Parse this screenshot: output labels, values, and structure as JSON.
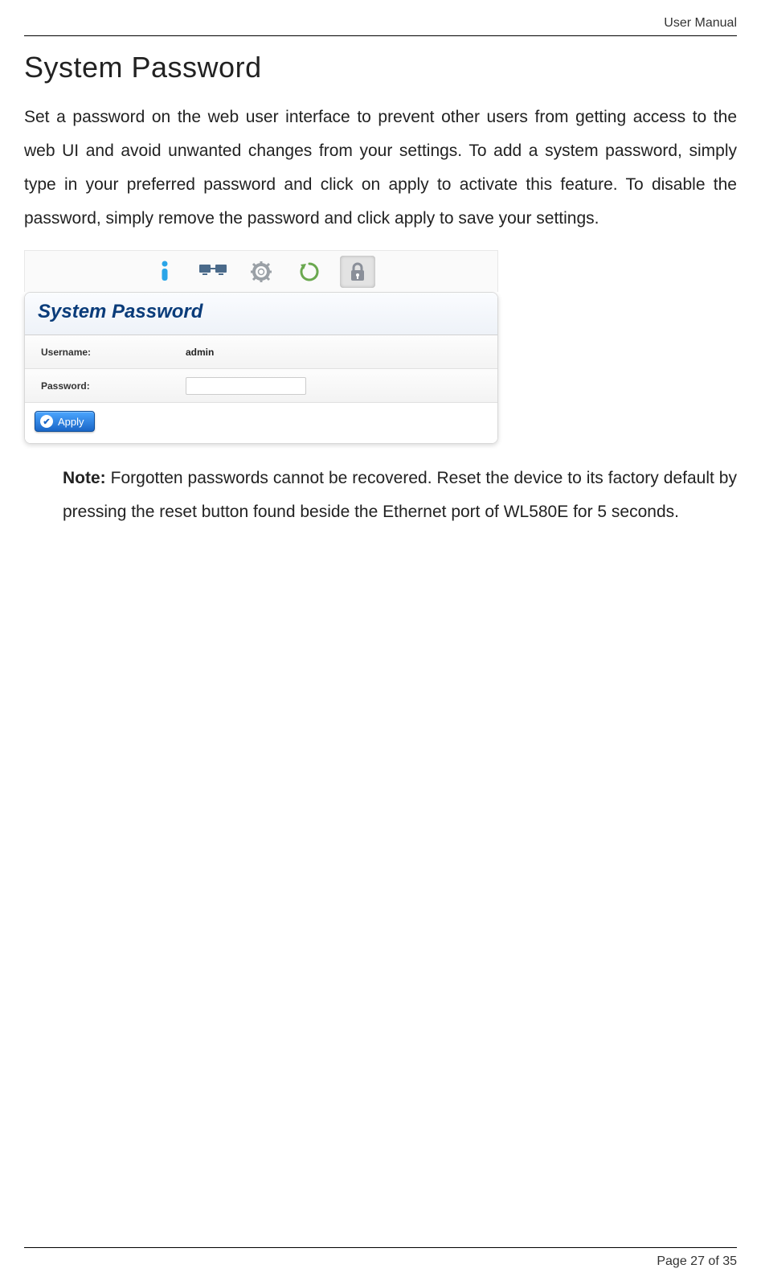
{
  "header": {
    "label": "User Manual"
  },
  "title": "System Password",
  "body": "Set a password on the web user interface to prevent other users from getting access to the web UI and avoid unwanted changes from your settings. To add a system password, simply type in your preferred password and click on apply to activate this feature. To disable the password, simply remove the password and click apply to save your settings.",
  "screenshot": {
    "tabs": {
      "info_icon": "info-icon",
      "network_icon": "network-icon",
      "settings_icon": "gear-icon",
      "reboot_icon": "reboot-icon",
      "security_icon": "lock-icon"
    },
    "panel_title": "System Password",
    "username_label": "Username:",
    "username_value": "admin",
    "password_label": "Password:",
    "password_value": "",
    "apply_label": "Apply"
  },
  "note": {
    "prefix": "Note:",
    "text": " Forgotten passwords cannot be recovered. Reset the device to its factory default by pressing the reset button found beside the Ethernet port of WL580E for 5 seconds."
  },
  "footer": {
    "page_label": "Page 27 of 35"
  }
}
